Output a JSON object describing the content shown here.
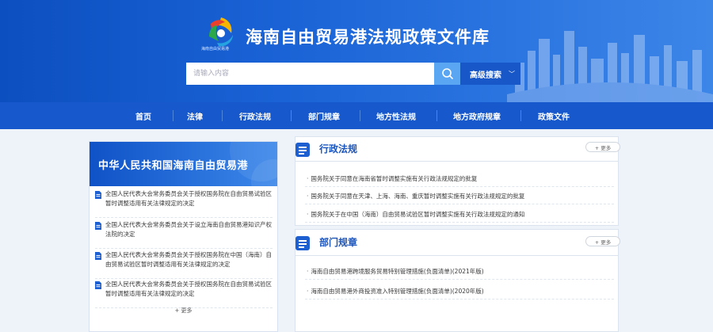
{
  "header": {
    "site_title": "海南自由贸易港法规政策文件库",
    "logo_subtitle": "海南自由贸易港",
    "search_placeholder": "请输入内容",
    "advanced_search_label": "高级搜索"
  },
  "nav": {
    "items": [
      "首页",
      "法律",
      "行政法规",
      "部门规章",
      "地方性法规",
      "地方政府规章",
      "政策文件"
    ]
  },
  "left": {
    "banner_title": "中华人民共和国海南自由贸易港",
    "items": [
      "全国人民代表大会常务委员会关于授权国务院在自由贸易试验区暂时调整适用有关法律规定的决定",
      "全国人民代表大会常务委员会关于设立海南自由贸易港知识产权法院的决定",
      "全国人民代表大会常务委员会关于授权国务院在中国（海南）自由贸易试验区暂时调整适用有关法律规定的决定",
      "全国人民代表大会常务委员会关于授权国务院在自由贸易试验区暂时调整适用有关法律规定的决定"
    ],
    "more_label": "+ 更多"
  },
  "sections": [
    {
      "title": "行政法规",
      "more_label": "+ 更多",
      "items": [
        "国务院关于同意在海南省暂时调整实施有关行政法规规定的批复",
        "国务院关于同意在天津、上海、海南、重庆暂时调整实施有关行政法规规定的批复",
        "国务院关于在中国（海南）自由贸易试验区暂时调整实施有关行政法规规定的通知"
      ]
    },
    {
      "title": "部门规章",
      "more_label": "+ 更多",
      "items": [
        "海南自由贸易港跨境服务贸易特别管理措施(负面清单)(2021年版)",
        "海南自由贸易港外商投资准入特别管理措施(负面清单)(2020年版)"
      ]
    }
  ],
  "colors": {
    "brand_blue": "#1759cc",
    "title_blue": "#1b55bd",
    "search_button": "#5aa6f3"
  }
}
